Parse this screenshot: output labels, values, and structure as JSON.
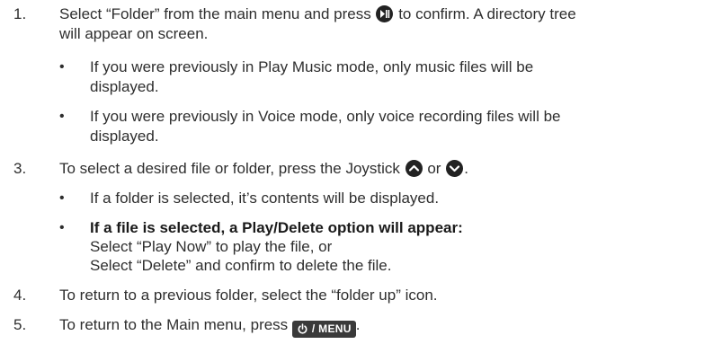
{
  "steps": {
    "s1": {
      "num": "1.",
      "pre": "Select “Folder” from the main menu and press ",
      "post": " to confirm. A directory tree",
      "line2": "will appear on screen.",
      "bullets": [
        {
          "l1": "If you were previously in Play Music mode, only music files will be",
          "l2": "displayed."
        },
        {
          "l1": "If you were previously in Voice mode, only voice recording files will be",
          "l2": "displayed."
        }
      ]
    },
    "s3": {
      "num": "3.",
      "pre": "To select a desired file or folder, press the Joystick ",
      "mid": " or ",
      "post": ".",
      "bullet1": "If a folder is selected, it’s contents will be displayed.",
      "bullet2": {
        "bold": "If a file is selected, a Play/Delete option will appear:",
        "l2": "Select “Play Now” to play the file, or",
        "l3": "Select “Delete” and confirm to delete the file."
      }
    },
    "s4": {
      "num": "4.",
      "text": "To return to a previous folder, select the “folder up” icon."
    },
    "s5": {
      "num": "5.",
      "pre": "To return to the Main menu, press ",
      "key": "/ MENU",
      "post": "."
    }
  },
  "icons": {
    "play_pause": "play-pause-icon",
    "up": "up-arrow-icon",
    "down": "down-arrow-icon",
    "power": "power-icon"
  },
  "bullet_char": "•"
}
